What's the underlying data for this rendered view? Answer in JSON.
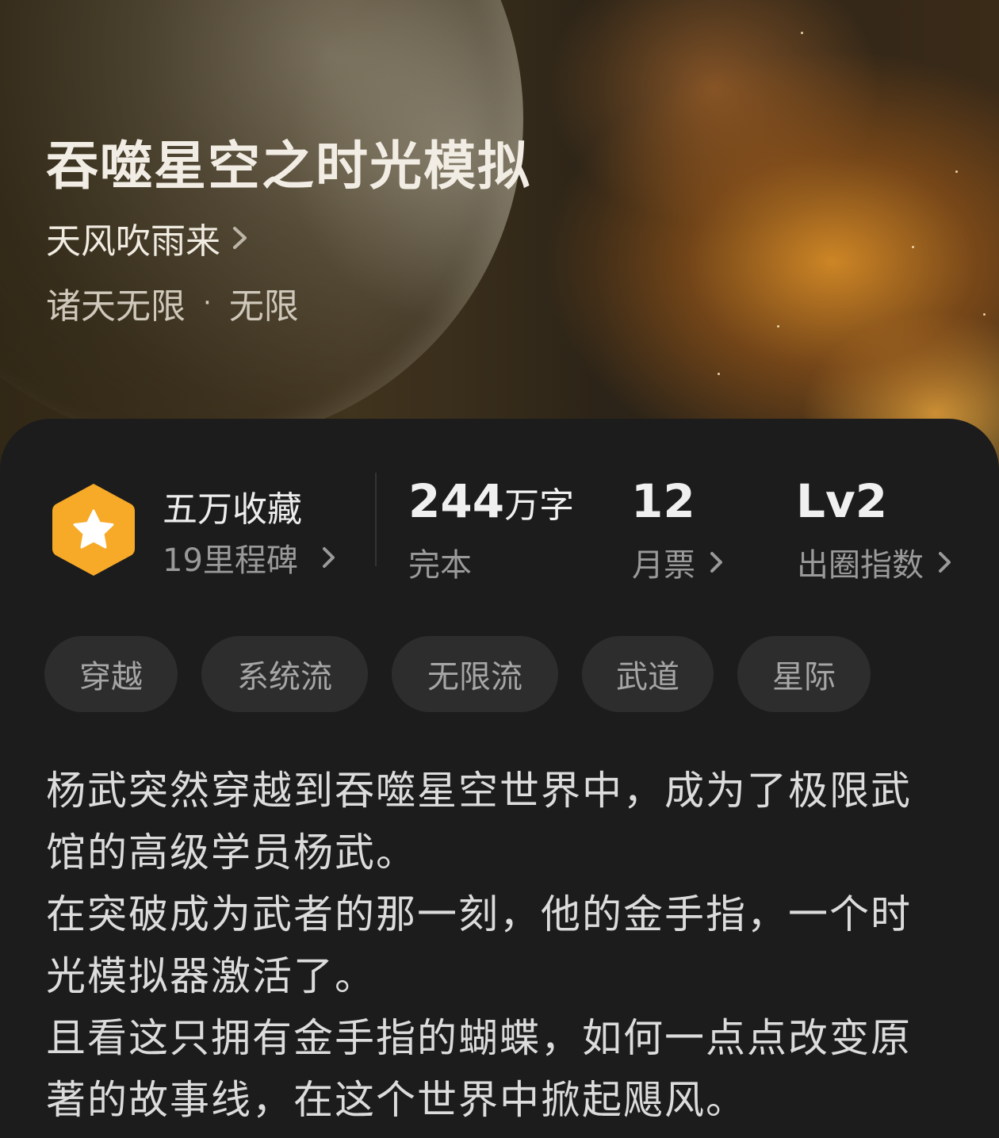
{
  "book": {
    "title": "吞噬星空之时光模拟",
    "author": "天风吹雨来",
    "genre_main": "诸天无限",
    "genre_dot": "·",
    "genre_sub": "无限"
  },
  "stats": {
    "favorites": "五万收藏",
    "milestones": "19里程碑",
    "word_count_num": "244",
    "word_count_unit": "万字",
    "status": "完本",
    "monthly_votes_num": "12",
    "monthly_votes_label": "月票",
    "breakout_level": "Lv2",
    "breakout_label": "出圈指数"
  },
  "tags": [
    "穿越",
    "系统流",
    "无限流",
    "武道",
    "星际"
  ],
  "synopsis": [
    "杨武突然穿越到吞噬星空世界中，成为了极限武馆的高级学员杨武。",
    "在突破成为武者的那一刻，他的金手指，一个时光模拟器激活了。",
    "且看这只拥有金手指的蝴蝶，如何一点点改变原著的故事线，在这个世界中掀起飓风。"
  ],
  "colors": {
    "badge": "#f7a928",
    "card_bg": "#1c1c1c",
    "tag_bg": "#2d2d2d"
  },
  "icons": {
    "badge": "hexagon-star-icon",
    "chevron": "chevron-right-icon"
  }
}
